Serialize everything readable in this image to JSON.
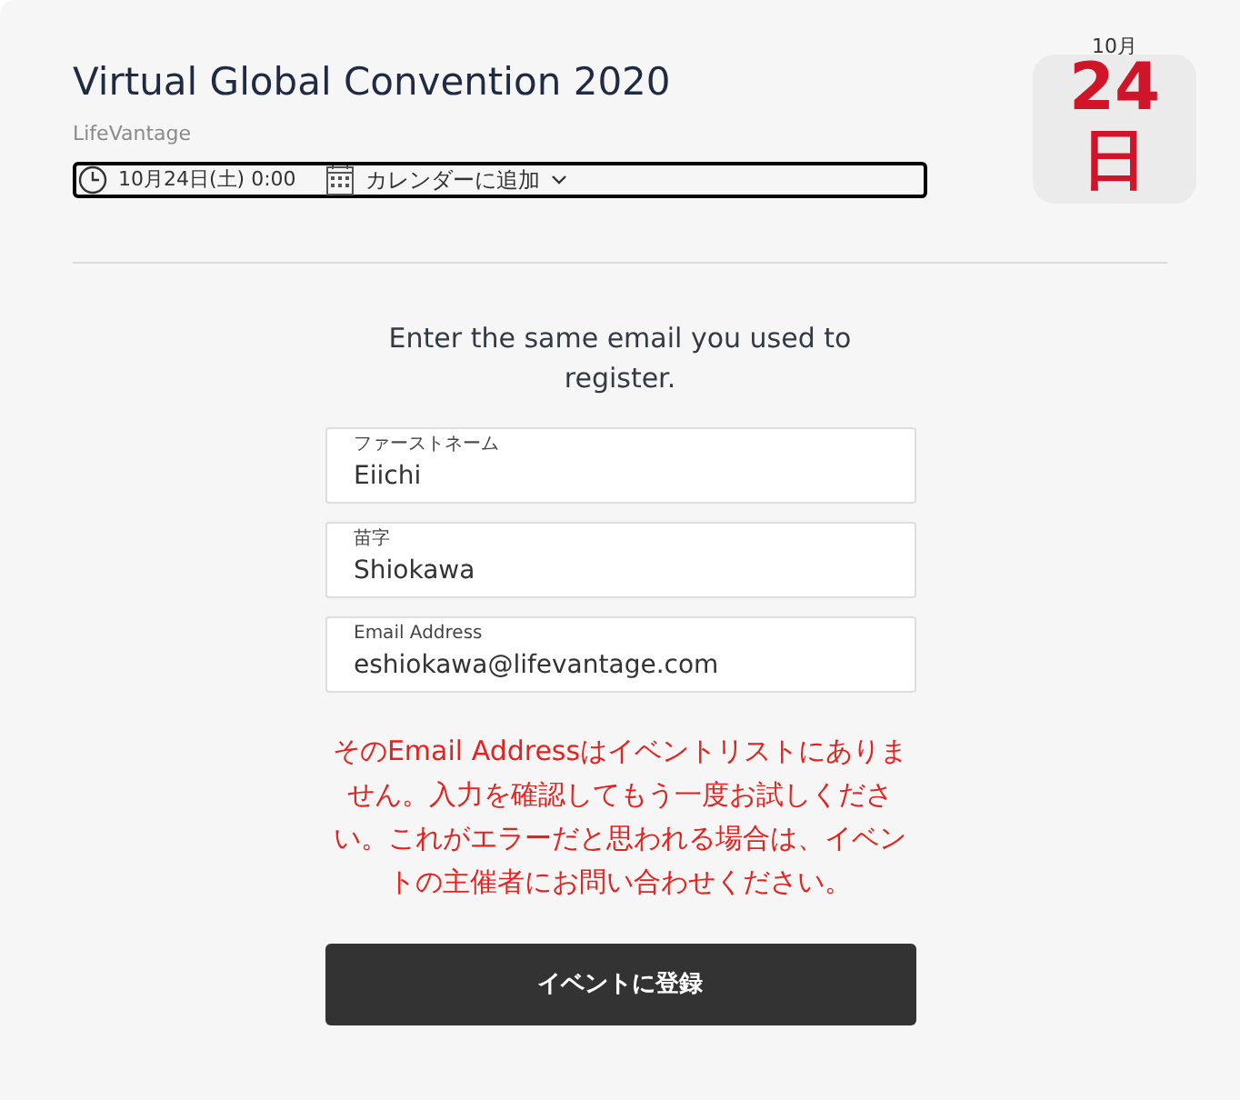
{
  "event": {
    "title": "Virtual Global Convention 2020",
    "organizer": "LifeVantage",
    "datetime": "10月24日(土) 0:00",
    "add_to_calendar": "カレンダーに追加"
  },
  "date_badge": {
    "month": "10月",
    "day": "24",
    "day_unit": "日"
  },
  "form": {
    "prompt": "Enter the same email you used to register.",
    "fields": [
      {
        "label": "ファーストネーム",
        "value": "Eiichi"
      },
      {
        "label": "苗字",
        "value": "Shiokawa"
      },
      {
        "label": "Email Address",
        "value": "eshiokawa@lifevantage.com"
      }
    ],
    "error": "そのEmail Addressはイベントリストにありません。入力を確認してもう一度お試しください。これがエラーだと思われる場合は、イベントの主催者にお問い合わせください。",
    "submit": "イベントに登録"
  }
}
